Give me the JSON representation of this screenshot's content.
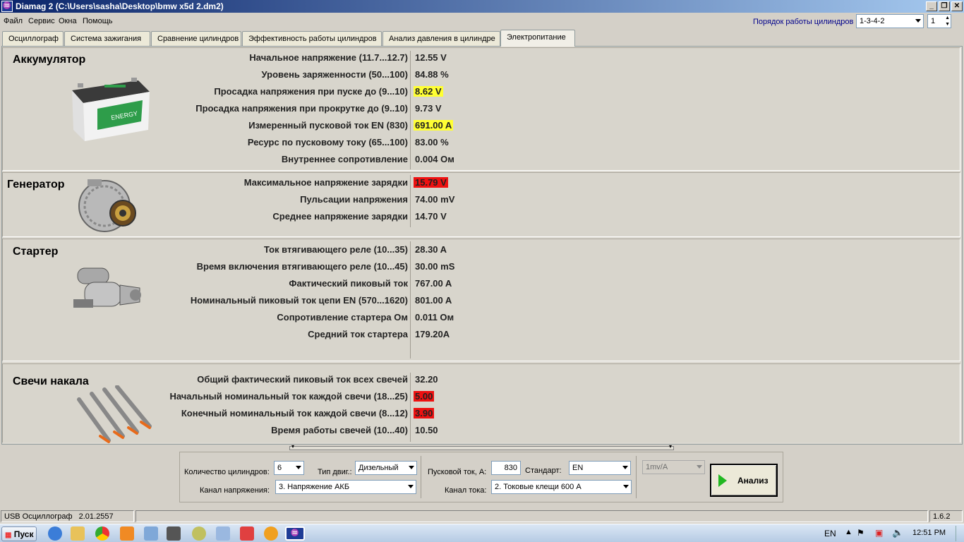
{
  "window": {
    "title": "Diamag 2 (C:\\Users\\sasha\\Desktop\\bmw x5d 2.dm2)",
    "app_icon": "diamag-icon"
  },
  "menu": [
    "Файл",
    "Сервис",
    "Окна",
    "Помощь"
  ],
  "firing_order": {
    "label": "Порядок работы цилиндров",
    "value": "1-3-4-2",
    "spin": "1"
  },
  "tabs": [
    "Осциллограф",
    "Система зажигания",
    "Сравнение цилиндров",
    "Эффективность работы цилиндров",
    "Анализ давления в цилиндре",
    "Электропитание"
  ],
  "active_tab": 5,
  "battery": {
    "title": "Аккумулятор",
    "rows": [
      {
        "label": "Начальное напряжение (11.7...12.7)",
        "value": "12.55 V",
        "hl": ""
      },
      {
        "label": "Уровень заряженности (50...100)",
        "value": "84.88 %",
        "hl": ""
      },
      {
        "label": "Просадка напряжения при пуске до (9...10)",
        "value": "8.62 V",
        "hl": "yellow"
      },
      {
        "label": "Просадка напряжения при прокрутке до  (9..10)",
        "value": "9.73 V",
        "hl": ""
      },
      {
        "label": "Измеренный пусковой ток  EN (830)",
        "value": "691.00 A",
        "hl": "yellow"
      },
      {
        "label": "Ресурс по пусковому току (65...100)",
        "value": "83.00 %",
        "hl": ""
      },
      {
        "label": "Внутреннее сопротивление",
        "value": "0.004 Ом",
        "hl": ""
      }
    ]
  },
  "generator": {
    "title": "Генератор",
    "rows": [
      {
        "label": "Максимальное напряжение зарядки",
        "value": "15.79 V",
        "hl": "red"
      },
      {
        "label": "Пульсации напряжения",
        "value": "74.00 mV",
        "hl": ""
      },
      {
        "label": "Среднее напряжение зарядки",
        "value": "14.70 V",
        "hl": ""
      }
    ]
  },
  "starter": {
    "title": "Стартер",
    "rows": [
      {
        "label": "Ток втягивающего реле (10...35)",
        "value": "28.30 A",
        "hl": ""
      },
      {
        "label": "Время включения втягивающего реле (10...45)",
        "value": "30.00 mS",
        "hl": ""
      },
      {
        "label": "Фактический пиковый ток",
        "value": "767.00 A",
        "hl": ""
      },
      {
        "label": "Номинальный пиковый ток цепи EN (570...1620)",
        "value": "801.00 A",
        "hl": ""
      },
      {
        "label": "Сопротивление стартера Ом",
        "value": "0.011 Ом",
        "hl": ""
      },
      {
        "label": "Средний ток стартера",
        "value": "179.20A",
        "hl": ""
      }
    ]
  },
  "glow": {
    "title": "Свечи накала",
    "rows": [
      {
        "label": "Общий фактический пиковый ток всех свечей",
        "value": "32.20",
        "hl": ""
      },
      {
        "label": "Начальный номинальный ток каждой свечи (18...25)",
        "value": "5.00",
        "hl": "red"
      },
      {
        "label": "Конечный номинальный ток каждой свечи (8...12)",
        "value": "3.90",
        "hl": "red"
      },
      {
        "label": "Время работы свечей (10...40)",
        "value": "10.50",
        "hl": ""
      }
    ]
  },
  "controls": {
    "cyl_label": "Количество цилиндров:",
    "cyl_value": "6",
    "engine_label": "Тип двиг.:",
    "engine_value": "Дизельный",
    "start_current_label": "Пусковой ток, А:",
    "start_current_value": "830",
    "standard_label": "Стандарт:",
    "standard_value": "EN",
    "scale_value": "1mv/A",
    "voltage_channel_label": "Канал напряжения:",
    "voltage_channel_value": "3. Напряжение АКБ",
    "current_channel_label": "Канал тока:",
    "current_channel_value": "2. Токовые клещи 600 A",
    "analyze_label": "Анализ"
  },
  "status": {
    "device": "USB Осциллограф",
    "version": "2.01.2557",
    "app_version": "1.6.2"
  },
  "taskbar": {
    "start": "Пуск",
    "lang": "EN",
    "time": "12:51 PM"
  },
  "colors": {
    "highlight_yellow": "#ffff33",
    "highlight_red": "#ee1111",
    "title_blue": "#0a246a"
  }
}
